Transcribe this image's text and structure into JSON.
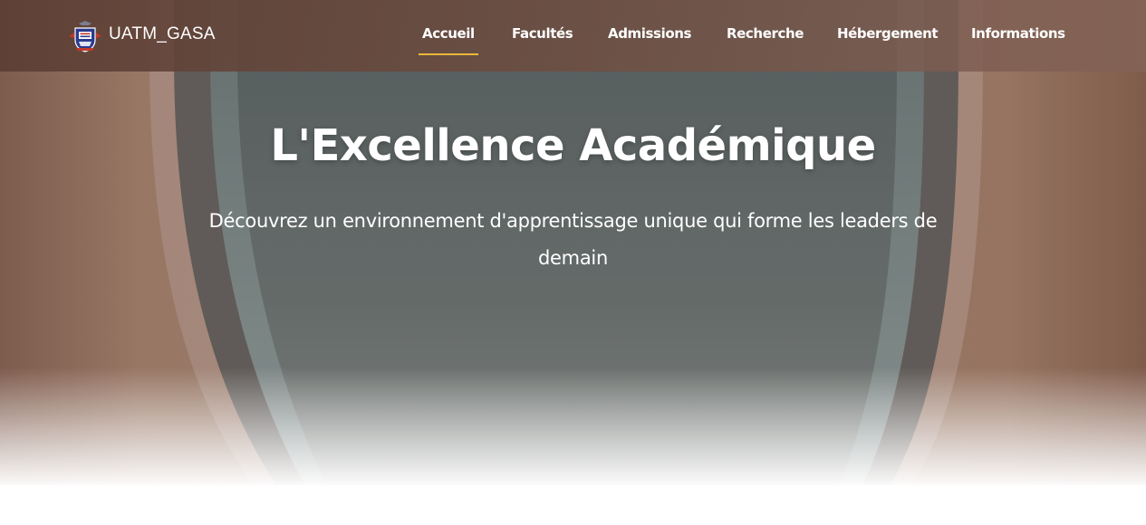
{
  "brand": {
    "name": "UATM_GASA",
    "logo": "university-crest-icon"
  },
  "nav": {
    "items": [
      {
        "label": "Accueil",
        "active": true
      },
      {
        "label": "Facultés",
        "active": false
      },
      {
        "label": "Admissions",
        "active": false
      },
      {
        "label": "Recherche",
        "active": false
      },
      {
        "label": "Hébergement",
        "active": false
      },
      {
        "label": "Informations",
        "active": false
      }
    ]
  },
  "hero": {
    "title": "L'Excellence Académique",
    "subtitle": "Découvrez un environnement d'apprentissage unique qui forme les leaders de demain"
  },
  "colors": {
    "accent": "#e9b93a",
    "navbar": "#6b4a3f",
    "text": "#ffffff"
  }
}
